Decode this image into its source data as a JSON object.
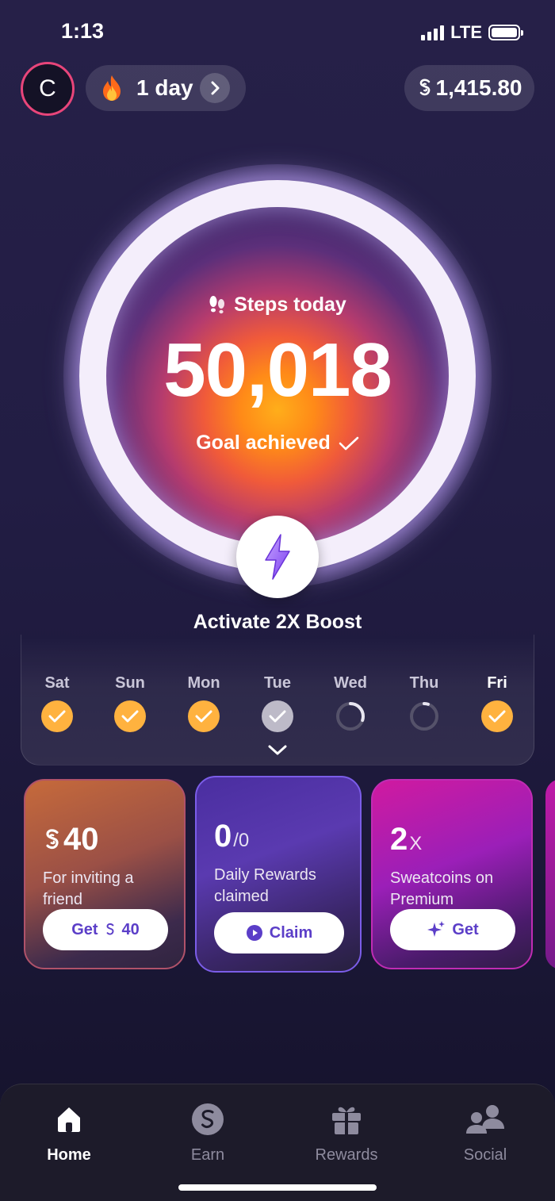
{
  "status_bar": {
    "time": "1:13",
    "network": "LTE"
  },
  "header": {
    "avatar_initial": "C",
    "streak_label": "1 day",
    "balance": "1,415.80"
  },
  "steps": {
    "label": "Steps today",
    "value": "50,018",
    "goal_text": "Goal achieved"
  },
  "boost": {
    "label": "Activate 2X Boost"
  },
  "week": {
    "days": [
      {
        "label": "Sat",
        "state": "done"
      },
      {
        "label": "Sun",
        "state": "done"
      },
      {
        "label": "Mon",
        "state": "done"
      },
      {
        "label": "Tue",
        "state": "partial"
      },
      {
        "label": "Wed",
        "state": "progress",
        "progress": 0.3
      },
      {
        "label": "Thu",
        "state": "progress",
        "progress": 0.05
      },
      {
        "label": "Fri",
        "state": "done"
      }
    ]
  },
  "cards": {
    "invite": {
      "amount": "40",
      "description": "For inviting a friend",
      "button": "Get",
      "button_amount": "40"
    },
    "daily": {
      "count": "0",
      "total": "/0",
      "description": "Daily Rewards claimed",
      "button": "Claim"
    },
    "premium": {
      "multiplier": "2",
      "suffix": "X",
      "description": "Sweatcoins on Premium",
      "button": "Get"
    }
  },
  "tabs": [
    {
      "label": "Home",
      "icon": "home-icon",
      "active": true
    },
    {
      "label": "Earn",
      "icon": "sweatcoin-icon",
      "active": false
    },
    {
      "label": "Rewards",
      "icon": "gift-icon",
      "active": false
    },
    {
      "label": "Social",
      "icon": "people-icon",
      "active": false
    }
  ],
  "colors": {
    "accent": "#5b3ec8",
    "done": "#ffb23f",
    "avatar_border": "#e8457a"
  }
}
